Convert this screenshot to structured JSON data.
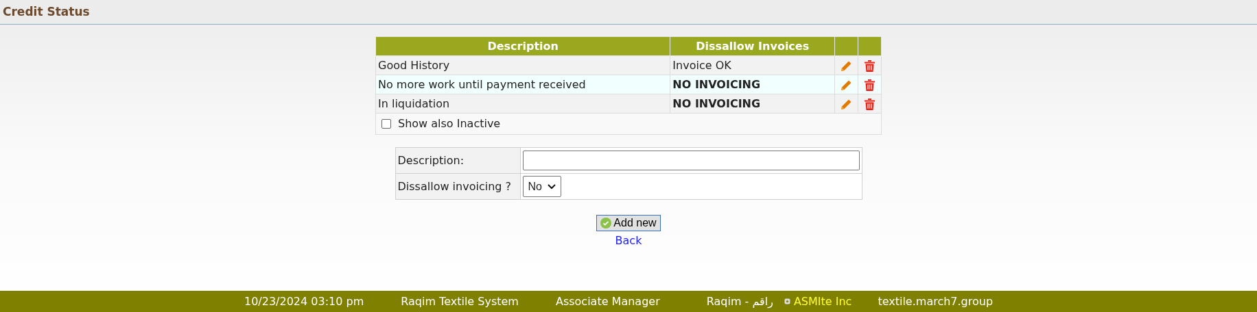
{
  "title": "Credit Status",
  "table": {
    "columns": [
      "Description",
      "Dissallow Invoices"
    ],
    "rows": [
      {
        "description": "Good History",
        "dissallow": "Invoice OK",
        "disallowed": false,
        "selected": false
      },
      {
        "description": "No more work until payment received",
        "dissallow": "NO INVOICING",
        "disallowed": true,
        "selected": true
      },
      {
        "description": "In liquidation",
        "dissallow": "NO INVOICING",
        "disallowed": true,
        "selected": false
      }
    ],
    "show_inactive": {
      "label": "Show also Inactive",
      "checked": false
    }
  },
  "form": {
    "description_label": "Description:",
    "dissallow_label": "Dissallow invoicing ?",
    "dissallow_value": "No"
  },
  "add_button": "Add new",
  "back_link": "Back",
  "status_bar": [
    {
      "text": "10/23/2024 03:10 pm",
      "kind": "plain"
    },
    {
      "text": "Raqim Textile System",
      "kind": "plain"
    },
    {
      "text": "Associate Manager",
      "kind": "plain"
    },
    {
      "text": "Raqim - راقم",
      "kind": "plain"
    },
    {
      "text": "ASMIte Inc",
      "kind": "company"
    },
    {
      "text": "textile.march7.group",
      "kind": "plain"
    }
  ]
}
